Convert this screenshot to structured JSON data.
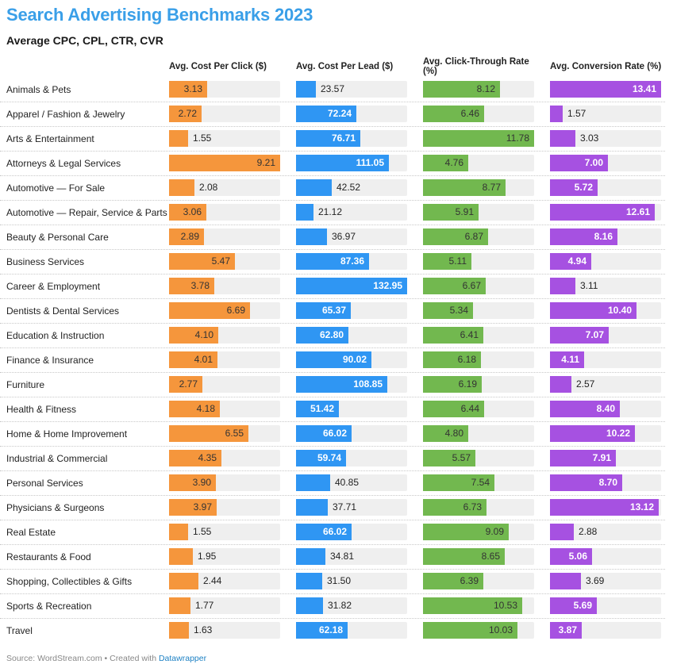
{
  "title": "Search Advertising Benchmarks 2023",
  "subtitle": "Average CPC, CPL, CTR, CVR",
  "footer": {
    "source_text": "Source: WordStream.com • Created with ",
    "link_text": "Datawrapper"
  },
  "chart_data": {
    "type": "bar",
    "title": "Search Advertising Benchmarks 2023",
    "subtitle": "Average CPC, CPL, CTR, CVR",
    "categories": [
      "Animals & Pets",
      "Apparel / Fashion & Jewelry",
      "Arts & Entertainment",
      "Attorneys & Legal Services",
      "Automotive — For Sale",
      "Automotive — Repair, Service & Parts",
      "Beauty & Personal Care",
      "Business Services",
      "Career & Employment",
      "Dentists & Dental Services",
      "Education & Instruction",
      "Finance & Insurance",
      "Furniture",
      "Health & Fitness",
      "Home & Home Improvement",
      "Industrial & Commercial",
      "Personal Services",
      "Physicians & Surgeons",
      "Real Estate",
      "Restaurants & Food",
      "Shopping, Collectibles & Gifts",
      "Sports & Recreation",
      "Travel"
    ],
    "series": [
      {
        "name": "Avg. Cost Per Click ($)",
        "color": "#f5963c",
        "label_light": false,
        "max": 9.21,
        "labels": [
          "3.13",
          "2.72",
          "1.55",
          "9.21",
          "2.08",
          "3.06",
          "2.89",
          "5.47",
          "3.78",
          "6.69",
          "4.10",
          "4.01",
          "2.77",
          "4.18",
          "6.55",
          "4.35",
          "3.90",
          "3.97",
          "1.55",
          "1.95",
          "2.44",
          "1.77",
          "1.63"
        ],
        "values": [
          3.13,
          2.72,
          1.55,
          9.21,
          2.08,
          3.06,
          2.89,
          5.47,
          3.78,
          6.69,
          4.1,
          4.01,
          2.77,
          4.18,
          6.55,
          4.35,
          3.9,
          3.97,
          1.55,
          1.95,
          2.44,
          1.77,
          1.63
        ]
      },
      {
        "name": "Avg. Cost Per Lead ($)",
        "color": "#2f96f3",
        "label_light": true,
        "max": 132.95,
        "labels": [
          "23.57",
          "72.24",
          "76.71",
          "111.05",
          "42.52",
          "21.12",
          "36.97",
          "87.36",
          "132.95",
          "65.37",
          "62.80",
          "90.02",
          "108.85",
          "51.42",
          "66.02",
          "59.74",
          "40.85",
          "37.71",
          "66.02",
          "34.81",
          "31.50",
          "31.82",
          "62.18"
        ],
        "values": [
          23.57,
          72.24,
          76.71,
          111.05,
          42.52,
          21.12,
          36.97,
          87.36,
          132.95,
          65.37,
          62.8,
          90.02,
          108.85,
          51.42,
          66.02,
          59.74,
          40.85,
          37.71,
          66.02,
          34.81,
          31.5,
          31.82,
          62.18
        ]
      },
      {
        "name": "Avg. Click-Through Rate (%)",
        "color": "#72b84f",
        "label_light": false,
        "max": 11.78,
        "labels": [
          "8.12",
          "6.46",
          "11.78",
          "4.76",
          "8.77",
          "5.91",
          "6.87",
          "5.11",
          "6.67",
          "5.34",
          "6.41",
          "6.18",
          "6.19",
          "6.44",
          "4.80",
          "5.57",
          "7.54",
          "6.73",
          "9.09",
          "8.65",
          "6.39",
          "10.53",
          "10.03"
        ],
        "values": [
          8.12,
          6.46,
          11.78,
          4.76,
          8.77,
          5.91,
          6.87,
          5.11,
          6.67,
          5.34,
          6.41,
          6.18,
          6.19,
          6.44,
          4.8,
          5.57,
          7.54,
          6.73,
          9.09,
          8.65,
          6.39,
          10.53,
          10.03
        ]
      },
      {
        "name": "Avg. Conversion Rate (%)",
        "color": "#a651e1",
        "label_light": true,
        "max": 13.41,
        "labels": [
          "13.41",
          "1.57",
          "3.03",
          "7.00",
          "5.72",
          "12.61",
          "8.16",
          "4.94",
          "3.11",
          "10.40",
          "7.07",
          "4.11",
          "2.57",
          "8.40",
          "10.22",
          "7.91",
          "8.70",
          "13.12",
          "2.88",
          "5.06",
          "3.69",
          "5.69",
          "3.87"
        ],
        "values": [
          13.41,
          1.57,
          3.03,
          7.0,
          5.72,
          12.61,
          8.16,
          4.94,
          3.11,
          10.4,
          7.07,
          4.11,
          2.57,
          8.4,
          10.22,
          7.91,
          8.7,
          13.12,
          2.88,
          5.06,
          3.69,
          5.69,
          3.87
        ]
      }
    ],
    "xlabel": "",
    "ylabel": "",
    "grid": false,
    "legend": "column-headers"
  }
}
